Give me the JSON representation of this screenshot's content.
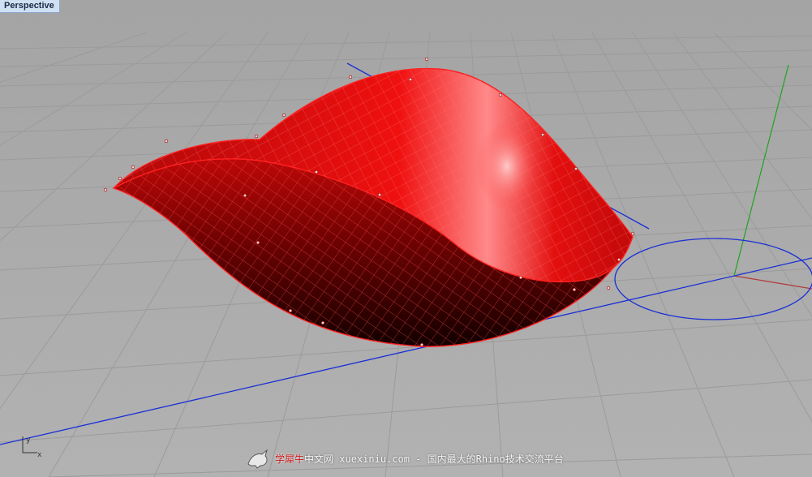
{
  "viewport": {
    "label": "Perspective"
  },
  "axes": {
    "y_label": "y",
    "x_label": "x"
  },
  "watermark": {
    "brand": "学犀牛",
    "text": "中文网 xuexiniu.com  - 国内最大的Rhino技术交流平台"
  },
  "icons": {
    "logo": "rhino-icon",
    "axes": "world-axes-icon"
  },
  "colors": {
    "background": "#a9a9a9",
    "grid": "#9b9b9b",
    "surface": "#d40a0a",
    "surface_highlight": "#ff6a6a",
    "x_axis": "#b23a3a",
    "y_axis": "#1fa31f",
    "curves": "#1a2fd6"
  }
}
